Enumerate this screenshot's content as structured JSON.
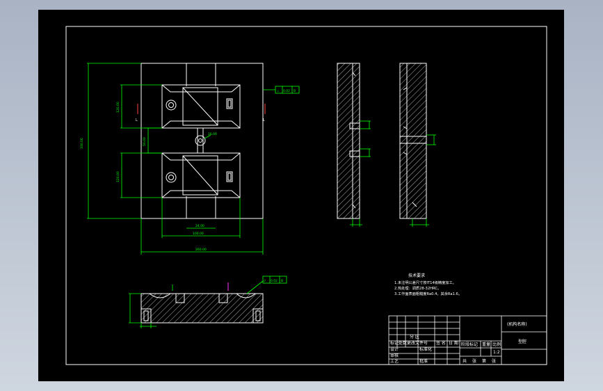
{
  "drawing": {
    "title_block": {
      "name_label": "(机构名称)",
      "drawing_title": "型腔",
      "cells": {
        "fenqu": "分 区",
        "biaoji": "标记",
        "shuliang": "处数",
        "gengai": "更改文件号",
        "qianming": "签 名",
        "riqi": "日 期",
        "sheji": "设计",
        "biaozhunhua": "标准化",
        "jieduan": "阶段标记",
        "zhongliang": "重量",
        "bili": "比例",
        "bili_value": "1:2",
        "shenhe": "审核",
        "gongyi": "工艺",
        "pizhun": "批准",
        "gong": "共",
        "zhang": "张",
        "di": "第",
        "zhang2": "张"
      }
    },
    "tech_requirements": {
      "heading": "技术要求",
      "lines": [
        "1.未注明公差尺寸按IT14级精度加工。",
        "2.热处理：调质28-32HRC。",
        "3.工作面表面粗糙度Ra0.4，其余Ra1.6。"
      ]
    },
    "tolerance_frames": {
      "top_view": [
        "⊥",
        "0.02",
        "B"
      ],
      "section_view": [
        "//",
        "0.02",
        "B"
      ]
    },
    "section_marks": {
      "left": "L",
      "right": "L"
    },
    "dimensions": {
      "overall_width": "260.00",
      "overall_height": "330.00",
      "cavity_width": "100.00",
      "cavity_height": "120.00",
      "center_gap": "50.00",
      "slot_width": "24.00",
      "slot_depth": "16.00"
    }
  }
}
